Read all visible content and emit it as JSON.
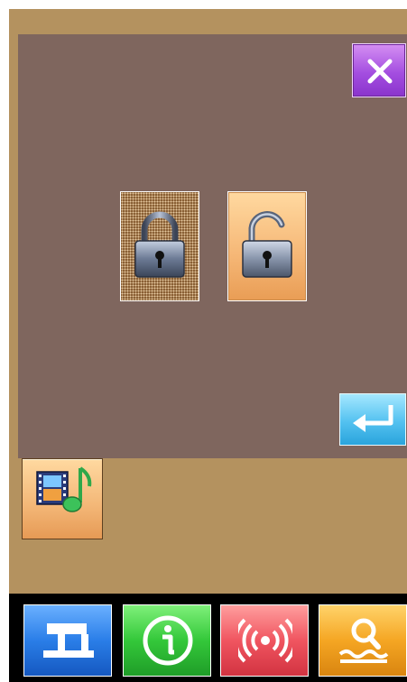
{
  "screen": {
    "background": "#b4925f"
  },
  "dialog": {
    "background": "#7f665e",
    "close_button": {
      "icon": "close-icon",
      "color": "#a44ee0"
    },
    "lock_options": [
      {
        "name": "lock",
        "icon": "lock-closed-icon",
        "selected": true
      },
      {
        "name": "unlock",
        "icon": "lock-open-icon",
        "selected": false
      }
    ],
    "enter_button": {
      "icon": "enter-return-icon",
      "color": "#53c1f0"
    }
  },
  "media_button": {
    "icon": "film-music-icon"
  },
  "bottom_nav": [
    {
      "name": "sewing",
      "icon": "sewing-machine-icon",
      "color": "#2a7ee8"
    },
    {
      "name": "information",
      "icon": "info-icon",
      "color": "#34c83a"
    },
    {
      "name": "communication",
      "icon": "wireless-signal-icon",
      "color": "#f05560"
    },
    {
      "name": "search",
      "icon": "search-icon",
      "color": "#f5a623"
    }
  ]
}
